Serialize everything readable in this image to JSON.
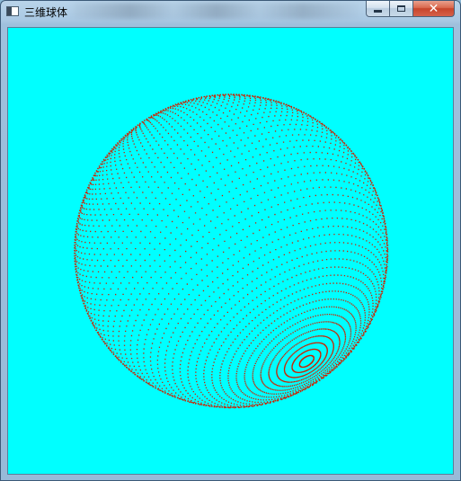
{
  "window": {
    "title": "三维球体",
    "close_glyph": "✕"
  },
  "canvas": {
    "background": "#00ffff",
    "sphere_color": "#cc2200",
    "sphere_label": "sphere"
  },
  "icons": {
    "app": "app-window-icon",
    "minimize": "minimize-icon",
    "maximize": "maximize-icon",
    "close": "close-icon"
  }
}
